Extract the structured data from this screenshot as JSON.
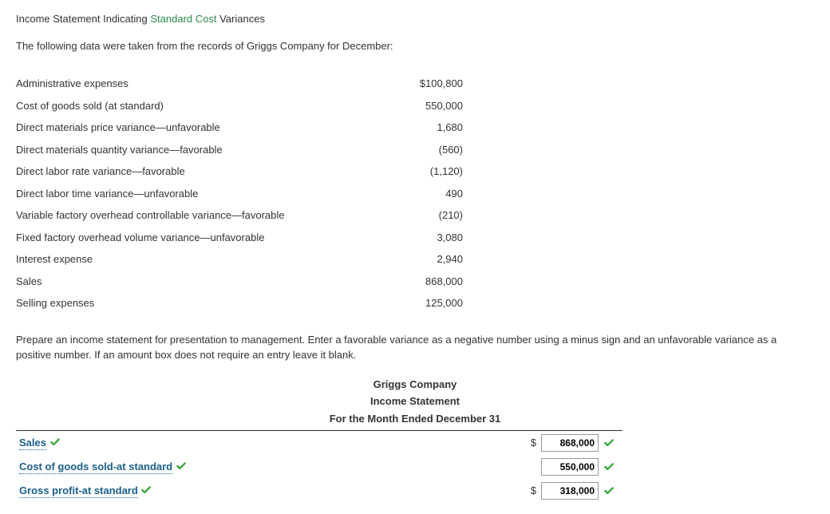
{
  "title": {
    "pre": "Income Statement Indicating ",
    "highlight": "Standard Cost",
    "post": " Variances"
  },
  "intro": "The following data were taken from the records of Griggs Company for December:",
  "records": [
    {
      "label": "Administrative expenses",
      "value": "$100,800"
    },
    {
      "label": "Cost of goods sold (at standard)",
      "value": "550,000"
    },
    {
      "label": "Direct materials price variance—unfavorable",
      "value": "1,680"
    },
    {
      "label": "Direct materials quantity variance—favorable",
      "value": "(560)"
    },
    {
      "label": "Direct labor rate variance—favorable",
      "value": "(1,120)"
    },
    {
      "label": "Direct labor time variance—unfavorable",
      "value": "490"
    },
    {
      "label": "Variable factory overhead controllable variance—favorable",
      "value": "(210)"
    },
    {
      "label": "Fixed factory overhead volume variance—unfavorable",
      "value": "3,080"
    },
    {
      "label": "Interest expense",
      "value": "2,940"
    },
    {
      "label": "Sales",
      "value": "868,000"
    },
    {
      "label": "Selling expenses",
      "value": "125,000"
    }
  ],
  "instructions": "Prepare an income statement for presentation to management. Enter a favorable variance as a negative number using a minus sign and an unfavorable variance as a positive number. If an amount box does not require an entry leave it blank.",
  "worksheet_heading": {
    "company": "Griggs Company",
    "statement": "Income Statement",
    "period": "For the Month Ended December 31"
  },
  "worksheet_rows": [
    {
      "label": "Sales",
      "dollar": "$",
      "value": "868,000"
    },
    {
      "label": "Cost of goods sold-at standard",
      "dollar": "",
      "value": "550,000"
    },
    {
      "label": "Gross profit-at standard",
      "dollar": "$",
      "value": "318,000"
    }
  ]
}
